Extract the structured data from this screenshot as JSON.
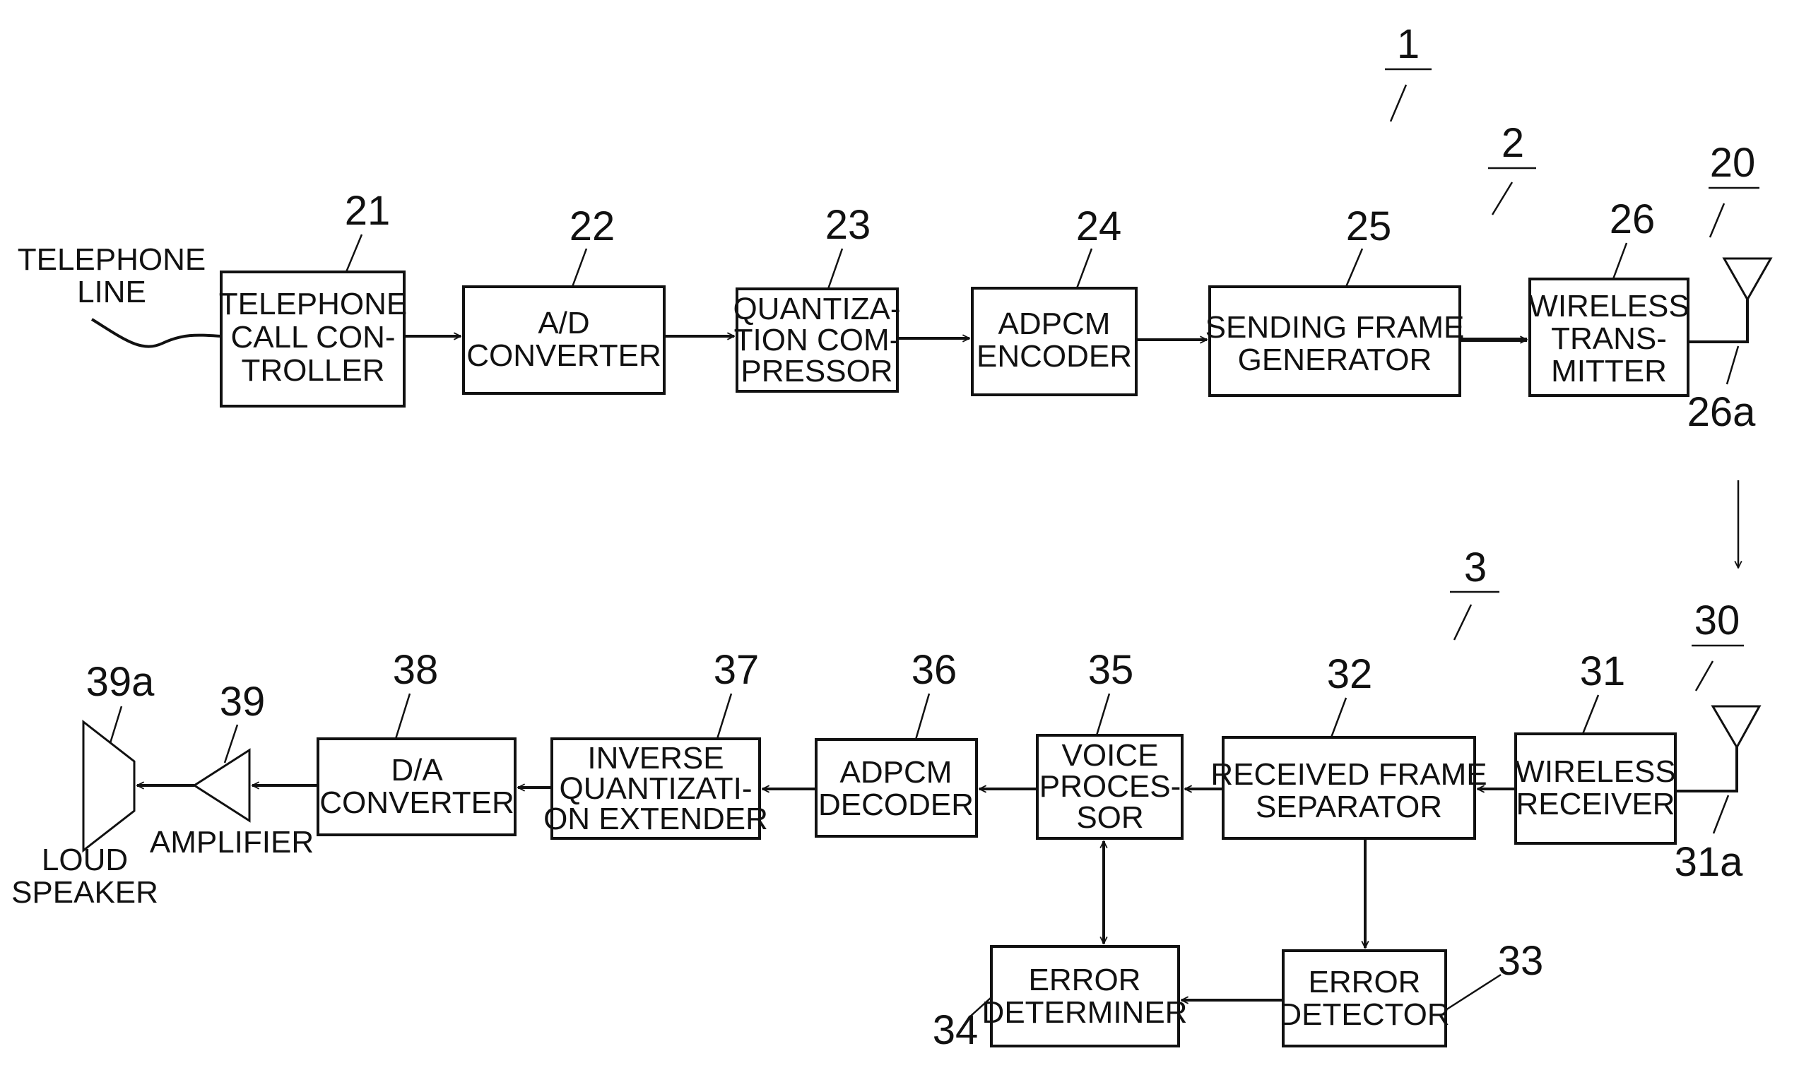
{
  "diagram": {
    "system_ref": "1",
    "transmitter_ref": "2",
    "receiver_ref": "3",
    "transmit_antenna_ref": "20",
    "receive_antenna_ref": "30",
    "external_labels": {
      "telephone_line": [
        "TELEPHONE",
        "LINE"
      ],
      "amplifier": "AMPLIFIER",
      "loud_speaker": [
        "LOUD",
        "SPEAKER"
      ]
    },
    "blocks": [
      {
        "id": "21",
        "lines": [
          "TELEPHONE",
          "CALL CON-",
          "TROLLER"
        ]
      },
      {
        "id": "22",
        "lines": [
          "A/D",
          "CONVERTER"
        ]
      },
      {
        "id": "23",
        "lines": [
          "QUANTIZA-",
          "TION COM-",
          "PRESSOR"
        ]
      },
      {
        "id": "24",
        "lines": [
          "ADPCM",
          "ENCODER"
        ]
      },
      {
        "id": "25",
        "lines": [
          "SENDING FRAME",
          "GENERATOR"
        ]
      },
      {
        "id": "26",
        "lines": [
          "WIRELESS",
          "TRANS-",
          "MITTER"
        ]
      },
      {
        "id": "31",
        "lines": [
          "WIRELESS",
          "RECEIVER"
        ]
      },
      {
        "id": "32",
        "lines": [
          "RECEIVED FRAME",
          "SEPARATOR"
        ]
      },
      {
        "id": "33",
        "lines": [
          "ERROR",
          "DETECTOR"
        ]
      },
      {
        "id": "34",
        "lines": [
          "ERROR",
          "DETERMINER"
        ]
      },
      {
        "id": "35",
        "lines": [
          "VOICE",
          "PROCES-",
          "SOR"
        ]
      },
      {
        "id": "36",
        "lines": [
          "ADPCM",
          "DECODER"
        ]
      },
      {
        "id": "37",
        "lines": [
          "INVERSE",
          "QUANTIZATI-",
          "ON EXTENDER"
        ]
      },
      {
        "id": "38",
        "lines": [
          "D/A",
          "CONVERTER"
        ]
      }
    ],
    "components": {
      "amplifier_ref": "39",
      "speaker_ref": "39a",
      "tx_antenna_port_ref": "26a",
      "rx_antenna_port_ref": "31a"
    }
  }
}
